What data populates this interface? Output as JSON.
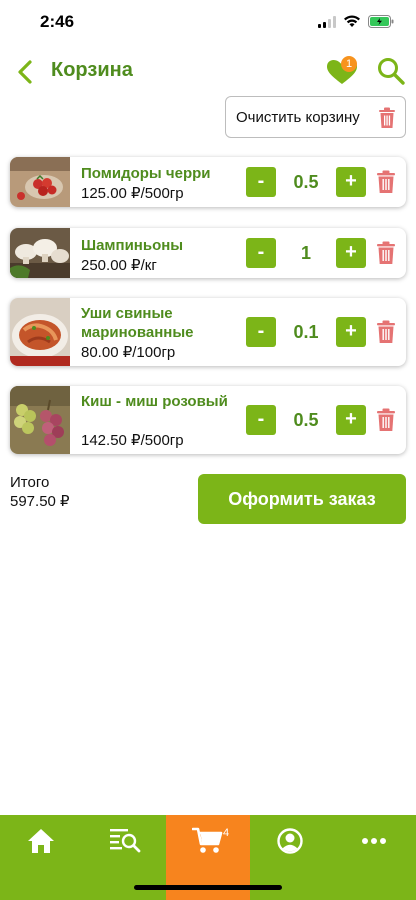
{
  "status_bar": {
    "time": "2:46"
  },
  "header": {
    "title": "Корзина",
    "favorites_badge": "1"
  },
  "clear_cart": {
    "label": "Очистить корзину"
  },
  "cart_items": [
    {
      "name": "Помидоры черри",
      "price": "125.00 ₽/500гр",
      "qty": "0.5",
      "image": "cherry-tomatoes"
    },
    {
      "name": "Шампиньоны",
      "price": "250.00 ₽/кг",
      "qty": "1",
      "image": "champignons"
    },
    {
      "name": "Уши свиные маринованные",
      "price": "80.00 ₽/100гр",
      "qty": "0.1",
      "image": "marinated-pork-ears"
    },
    {
      "name": "Киш - миш розовый",
      "price": "142.50 ₽/500гр",
      "qty": "0.5",
      "image": "pink-grapes"
    }
  ],
  "qty_controls": {
    "minus": "-",
    "plus": "+"
  },
  "summary": {
    "total_label": "Итого",
    "total_value": "597.50 ₽",
    "order_button": "Оформить заказ"
  },
  "tab_bar": {
    "active": "cart",
    "cart_badge": "4",
    "tabs": [
      "home-icon",
      "catalog-search-icon",
      "cart-icon",
      "profile-icon",
      "more-icon"
    ]
  },
  "colors": {
    "brand_green": "#7cb518",
    "title_green": "#4f8c1e",
    "active_tab_orange": "#f7841e",
    "delete_red": "#e57373"
  }
}
